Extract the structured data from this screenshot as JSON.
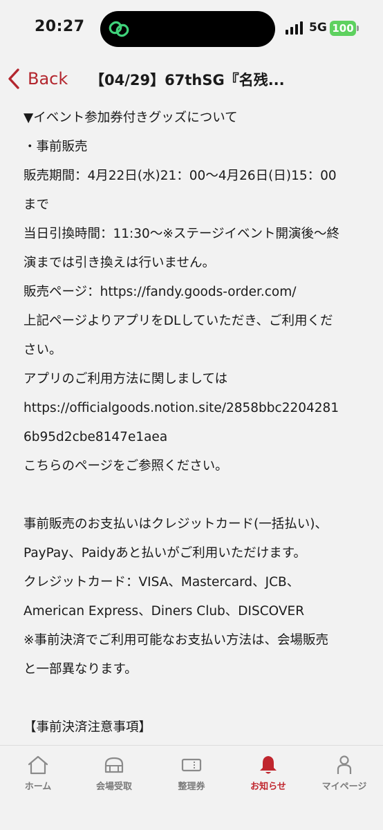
{
  "status_bar": {
    "time": "20:27",
    "network": "5G",
    "battery": "100"
  },
  "nav": {
    "back_label": "Back",
    "title": "【04/29】67thSG『名残..."
  },
  "content": {
    "lines": [
      "▼イベント参加券付きグッズについて",
      "・事前販売",
      "販売期間：4月22日(水)21：00〜4月26日(日)15：00",
      "まで",
      "当日引換時間：11:30〜※ステージイベント開演後〜終",
      "演までは引き換えは行いません。",
      "販売ページ：https://fandy.goods-order.com/",
      "上記ページよりアプリをDLしていただき、ご利用くだ",
      "さい。",
      "アプリのご利用方法に関しましては",
      "https://officialgoods.notion.site/2858bbc2204281",
      "6b95d2cbe8147e1aea",
      "こちらのページをご参照ください。",
      "",
      "事前販売のお支払いはクレジットカード(一括払い)、",
      "PayPay、Paidyあと払いがご利用いただけます。",
      "クレジットカード：VISA、Mastercard、JCB、",
      "American Express、Diners Club、DISCOVER",
      "※事前決済でご利用可能なお支払い方法は、会場販売",
      "と一部異なります。",
      "",
      "【事前決済注意事項】"
    ]
  },
  "tabs": [
    {
      "label": "ホーム",
      "icon": "home-icon",
      "active": false
    },
    {
      "label": "会場受取",
      "icon": "venue-pickup-icon",
      "active": false
    },
    {
      "label": "整理券",
      "icon": "ticket-icon",
      "active": false
    },
    {
      "label": "お知らせ",
      "icon": "bell-icon",
      "active": true
    },
    {
      "label": "マイページ",
      "icon": "person-icon",
      "active": false
    }
  ],
  "colors": {
    "accent": "#c0262e",
    "battery": "#5ed15f",
    "inactive_tab": "#7a7a7a"
  }
}
